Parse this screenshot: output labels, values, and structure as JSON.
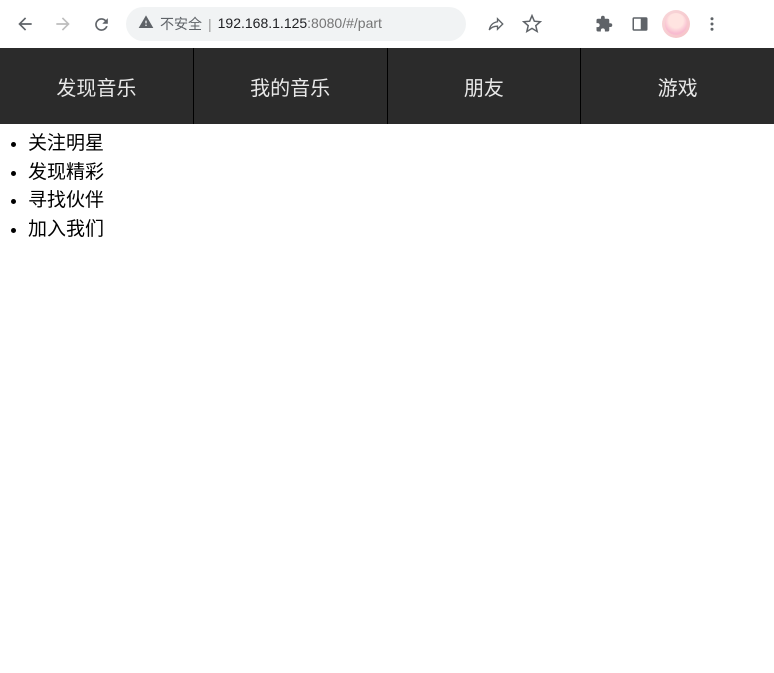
{
  "browser": {
    "insecure_label": "不安全",
    "url_host": "192.168.1.125",
    "url_port": ":8080",
    "url_path": "/#/part"
  },
  "tabs": [
    {
      "label": "发现音乐"
    },
    {
      "label": "我的音乐"
    },
    {
      "label": "朋友"
    },
    {
      "label": "游戏"
    }
  ],
  "sublist": [
    "关注明星",
    "发现精彩",
    "寻找伙伴",
    "加入我们"
  ]
}
